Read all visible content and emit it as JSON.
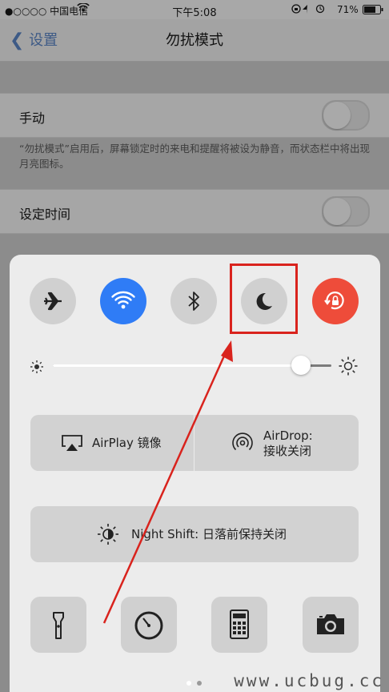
{
  "status_bar": {
    "carrier": "●○○○○ 中国电信",
    "time": "下午5:08",
    "battery": "71%"
  },
  "nav": {
    "back_label": "设置",
    "title": "勿扰模式"
  },
  "settings": {
    "manual_label": "手动",
    "manual_note": "“勿扰模式”启用后，屏幕锁定时的来电和提醒将被设为静音，而状态栏中将出现月亮图标。",
    "scheduled_label": "设定时间"
  },
  "control_center": {
    "toggles": [
      {
        "name": "airplane-mode",
        "icon": "airplane-icon",
        "active": false
      },
      {
        "name": "wifi",
        "icon": "wifi-icon",
        "active": true,
        "color": "#2f7cf6"
      },
      {
        "name": "bluetooth",
        "icon": "bluetooth-icon",
        "active": false
      },
      {
        "name": "do-not-disturb",
        "icon": "moon-icon",
        "active": false
      },
      {
        "name": "rotation-lock",
        "icon": "rotation-lock-icon",
        "active": true,
        "color": "#ee4c3a"
      }
    ],
    "brightness": {
      "level": 0.89
    },
    "airplay_label": "AirPlay 镜像",
    "airdrop_label_line1": "AirDrop:",
    "airdrop_label_line2": "接收关闭",
    "night_shift_label": "Night Shift: 日落前保持关闭",
    "shortcuts": [
      "flashlight-icon",
      "timer-icon",
      "calculator-icon",
      "camera-icon"
    ],
    "page_dots": {
      "count": 2,
      "current": 1
    }
  },
  "watermark": "www.ucbug.cc",
  "annotation": {
    "highlight_color": "#d9231d"
  }
}
